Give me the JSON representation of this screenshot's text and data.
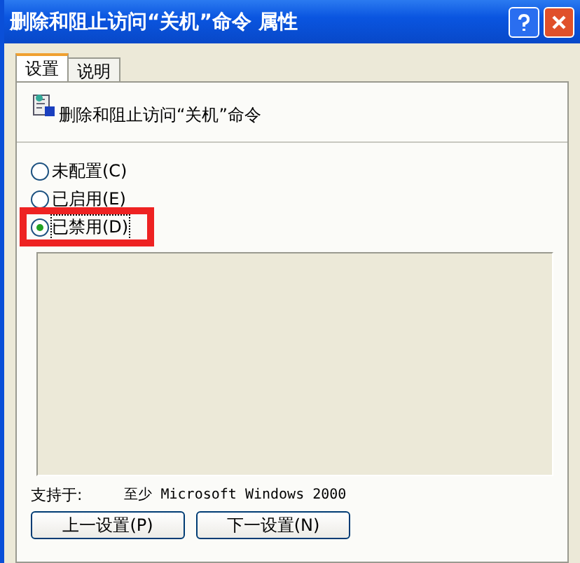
{
  "window": {
    "title": "删除和阻止访问“关机”命令 属性"
  },
  "tabs": [
    {
      "label": "设置",
      "selected": true
    },
    {
      "label": "说明",
      "selected": false
    }
  ],
  "setting_name": "删除和阻止访问“关机”命令",
  "options": [
    {
      "label": "未配置(C)",
      "selected": false,
      "highlighted": false
    },
    {
      "label": "已启用(E)",
      "selected": false,
      "highlighted": false
    },
    {
      "label": "已禁用(D)",
      "selected": true,
      "highlighted": true
    }
  ],
  "supported_label": "支持于:",
  "supported_value": "至少 Microsoft Windows 2000",
  "buttons": [
    "上一设置(P)",
    "下一设置(N)"
  ]
}
